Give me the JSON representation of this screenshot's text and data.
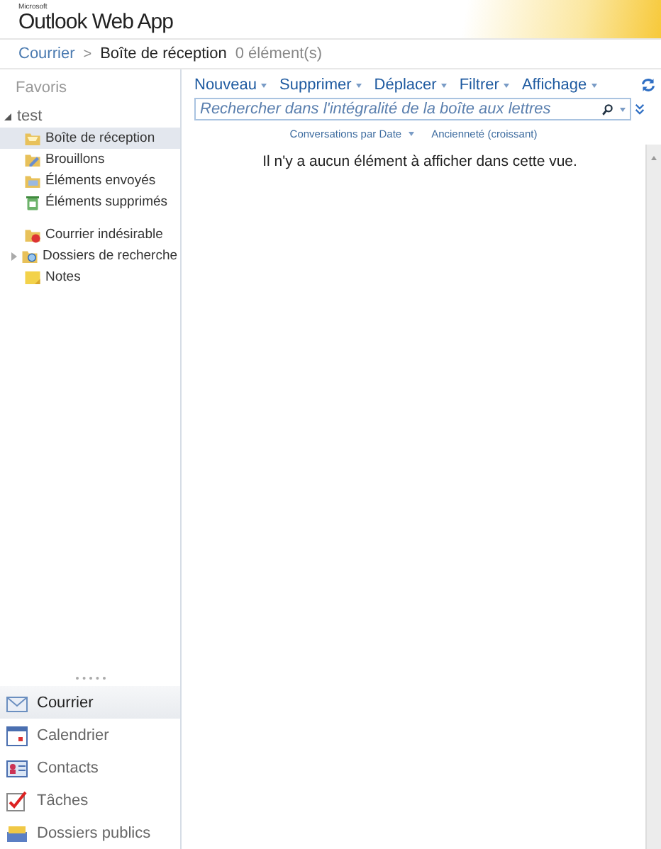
{
  "app": {
    "brand": "Microsoft",
    "title": "Outlook Web App"
  },
  "breadcrumb": {
    "root": "Courrier",
    "separator": ">",
    "current": "Boîte de réception",
    "count": "0 élément(s)"
  },
  "sidebar": {
    "favorites": "Favoris",
    "mailbox": {
      "name": "test",
      "expanded": true
    },
    "folders": [
      {
        "label": "Boîte de réception",
        "selected": true,
        "expandable": false
      },
      {
        "label": "Brouillons",
        "selected": false,
        "expandable": false
      },
      {
        "label": "Éléments envoyés",
        "selected": false,
        "expandable": false
      },
      {
        "label": "Éléments supprimés",
        "selected": false,
        "expandable": false
      },
      {
        "label": "Courrier indésirable",
        "selected": false,
        "expandable": false
      },
      {
        "label": "Dossiers de recherche",
        "selected": false,
        "expandable": true
      },
      {
        "label": "Notes",
        "selected": false,
        "expandable": false
      }
    ]
  },
  "navigation": [
    {
      "label": "Courrier",
      "selected": true
    },
    {
      "label": "Calendrier",
      "selected": false
    },
    {
      "label": "Contacts",
      "selected": false
    },
    {
      "label": "Tâches",
      "selected": false
    },
    {
      "label": "Dossiers publics",
      "selected": false
    }
  ],
  "toolbar": [
    "Nouveau",
    "Supprimer",
    "Déplacer",
    "Filtrer",
    "Affichage"
  ],
  "search": {
    "placeholder": "Rechercher dans l'intégralité de la boîte aux lettres"
  },
  "sort": {
    "arrange": "Conversations par Date",
    "order": "Ancienneté (croissant)"
  },
  "empty_message": "Il n'y a aucun élément à afficher dans cette vue."
}
